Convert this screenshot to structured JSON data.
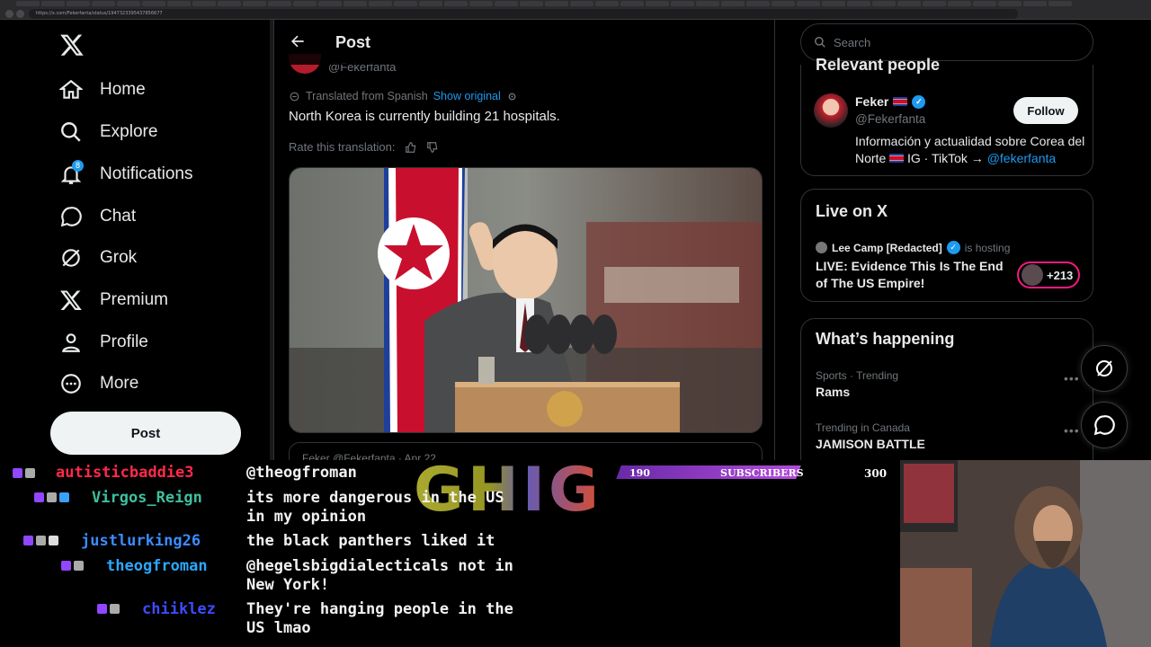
{
  "browser": {
    "url": "https://x.com/Fekerfanta/status/1947323395437856677"
  },
  "nav": {
    "items": [
      {
        "label": "Home",
        "icon": "home-icon"
      },
      {
        "label": "Explore",
        "icon": "search-icon"
      },
      {
        "label": "Notifications",
        "icon": "bell-icon",
        "badge": "8"
      },
      {
        "label": "Chat",
        "icon": "chat-bubble-icon"
      },
      {
        "label": "Grok",
        "icon": "grok-icon"
      },
      {
        "label": "Premium",
        "icon": "x-logo-icon"
      },
      {
        "label": "Profile",
        "icon": "person-icon"
      },
      {
        "label": "More",
        "icon": "more-circle-icon"
      }
    ],
    "post_button": "Post"
  },
  "post": {
    "header_title": "Post",
    "author_handle": "@Fekerfanta",
    "translated_label": "Translated from Spanish",
    "show_original": "Show original",
    "text": "North Korea is currently building 21 hospitals.",
    "rate_label": "Rate this translation:",
    "quote_peek": "Feker  @Fekerfanta · Apr 22"
  },
  "sidebar": {
    "search_placeholder": "Search",
    "relevant": {
      "title": "Relevant people",
      "name": "Feker",
      "handle": "@Fekerfanta",
      "follow": "Follow",
      "bio_1": "Información y actualidad sobre Corea del Norte",
      "bio_2": " IG · TikTok → ",
      "bio_link": "@fekerfanta"
    },
    "live": {
      "title": "Live on X",
      "host": "Lee Camp [Redacted]",
      "hosting": "is hosting",
      "stream_title": "LIVE: Evidence This Is The End of The US Empire!",
      "count": "+213"
    },
    "happening": {
      "title": "What’s happening",
      "trends": [
        {
          "meta": "Sports · Trending",
          "name": "Rams"
        },
        {
          "meta": "Trending in Canada",
          "name": "JAMISON BATTLE"
        }
      ]
    }
  },
  "overlay": {
    "sub_bar": {
      "current": "190",
      "label": "SUBSCRIBERS",
      "goal": "300"
    },
    "ghost": "GHIG",
    "chat": [
      {
        "user": "autisticbaddie3",
        "color": "#ff2a4a",
        "msg": "@theogfroman",
        "msg2": ""
      },
      {
        "user": "Virgos_Reign",
        "color": "#3fbf9f",
        "msg": "its more dangerous in the US",
        "msg2": "in my opinion"
      },
      {
        "user": "justlurking26",
        "color": "#3a8cff",
        "msg": "the black panthers liked it",
        "msg2": ""
      },
      {
        "user": "theogfroman",
        "color": "#2aa7ff",
        "msg": "@hegelsbigdialecticals not in",
        "msg2": "New York!"
      },
      {
        "user": "chiiklez",
        "color": "#3d4cff",
        "msg": "They're hanging people in the",
        "msg2": "US lmao"
      }
    ]
  }
}
